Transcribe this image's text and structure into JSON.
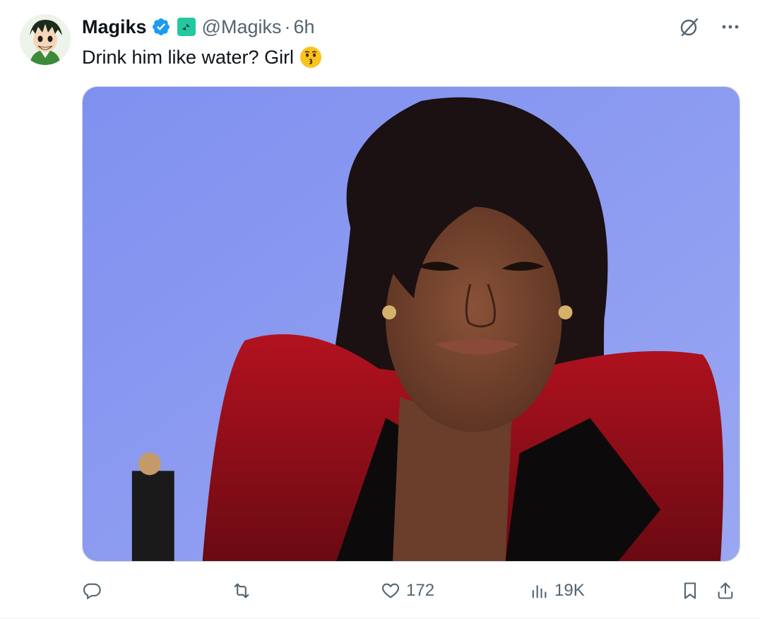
{
  "tweet": {
    "display_name": "Magiks",
    "handle": "@Magiks",
    "separator": "·",
    "time": "6h",
    "text": "Drink him like water? Girl",
    "emoji": "kissing-face-emoji"
  },
  "icons": {
    "verified": "verified-badge-icon",
    "affiliate": "affiliate-badge-icon",
    "grok": "grok-icon",
    "more": "more-icon"
  },
  "actions": {
    "reply_count": "",
    "retweet_count": "",
    "like_count": "172",
    "views_count": "19K"
  },
  "colors": {
    "verified_blue": "#1d9bf0",
    "affiliate_green": "#22c9a0",
    "secondary_text": "#536471",
    "media_bg": "#8c9ef2"
  }
}
